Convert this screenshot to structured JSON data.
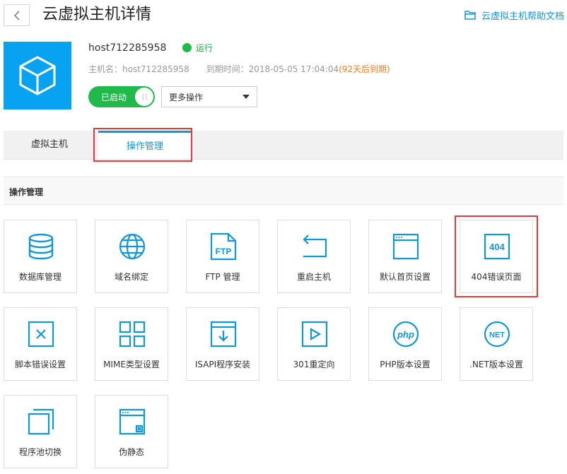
{
  "header": {
    "title": "云虚拟主机详情",
    "help_link": "云虚拟主机帮助文档"
  },
  "host": {
    "name": "host712285958",
    "status": "运行",
    "hostname_label": "主机名：",
    "hostname_value": "host712285958",
    "expire_label": "到期时间：",
    "expire_value": "2018-05-05 17:04:04",
    "remaining": "(92天后到期)",
    "toggle_label": "已启动",
    "more_actions": "更多操作"
  },
  "tabs": [
    {
      "label": "虚拟主机",
      "active": false
    },
    {
      "label": "操作管理",
      "active": true
    }
  ],
  "section": {
    "title": "操作管理"
  },
  "tiles": [
    {
      "label": "数据库管理",
      "icon": "database-icon"
    },
    {
      "label": "域名绑定",
      "icon": "globe-icon"
    },
    {
      "label": "FTP 管理",
      "icon": "ftp-folder-icon"
    },
    {
      "label": "重启主机",
      "icon": "restart-icon"
    },
    {
      "label": "默认首页设置",
      "icon": "browser-window-icon"
    },
    {
      "label": "404错误页面",
      "icon": "error-404-icon"
    },
    {
      "label": "脚本错误设置",
      "icon": "script-error-icon"
    },
    {
      "label": "MIME类型设置",
      "icon": "grid-icon"
    },
    {
      "label": "ISAPI程序安装",
      "icon": "install-icon"
    },
    {
      "label": "301重定向",
      "icon": "redirect-icon"
    },
    {
      "label": "PHP版本设置",
      "icon": "php-icon"
    },
    {
      "label": ".NET版本设置",
      "icon": "dotnet-icon"
    },
    {
      "label": "程序池切换",
      "icon": "pool-switch-icon"
    },
    {
      "label": "伪静态",
      "icon": "pseudo-static-icon"
    }
  ],
  "icon_texts": {
    "ftp": "FTP",
    "e404": "404",
    "php": "php",
    "net": "NET"
  },
  "colors": {
    "accent": "#1296db",
    "running": "#1fba4a",
    "highlight": "#e5393c",
    "host_tile": "#08a2f3",
    "remaining": "#f07a1d"
  }
}
